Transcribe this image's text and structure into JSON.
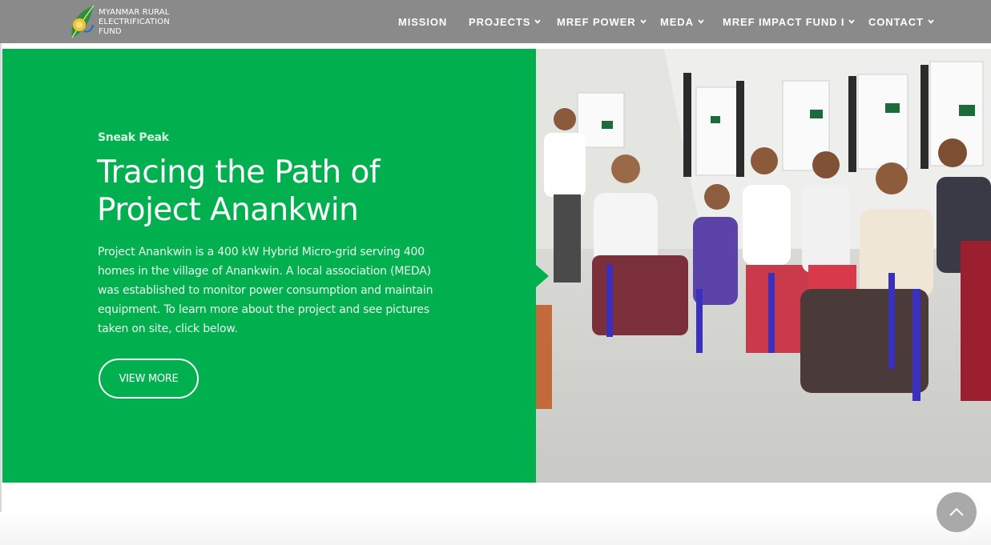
{
  "header": {
    "logo": {
      "line1": "MYANMAR RURAL",
      "line2": "ELECTRIFICATION",
      "line3": "FUND"
    },
    "nav": [
      {
        "label": "MISSION",
        "has_dropdown": false
      },
      {
        "label": "PROJECTS",
        "has_dropdown": true
      },
      {
        "label": "MREF POWER",
        "has_dropdown": true
      },
      {
        "label": "MEDA",
        "has_dropdown": true
      },
      {
        "label": "MREF IMPACT FUND I",
        "has_dropdown": true
      },
      {
        "label": "CONTACT",
        "has_dropdown": true
      }
    ]
  },
  "hero": {
    "eyebrow": "Sneak Peak",
    "title_line1": "Tracing the Path of",
    "title_line2": "Project Anankwin",
    "body": "Project Anankwin is a 400 kW Hybrid Micro-grid serving 400 homes in the village of Anankwin. A local association (MEDA) was established to monitor power consumption and maintain equipment. To learn more about the project and see pictures taken on site, click below.",
    "button_label": "VIEW MORE"
  },
  "icons": {
    "logo": "leaf-lightbulb-icon",
    "dropdown": "chevron-down-icon",
    "scroll_top": "chevron-up-icon"
  },
  "colors": {
    "header_bg": "#8a8a8a",
    "hero_green": "#00b04f",
    "scroll_top_bg": "#a9a9a9"
  }
}
